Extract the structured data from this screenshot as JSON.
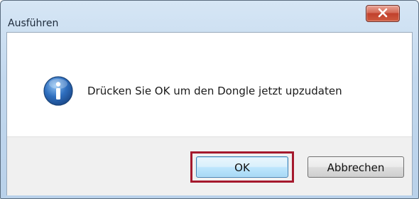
{
  "window": {
    "title": "Ausführen",
    "close_icon": "close-x-icon"
  },
  "message": {
    "icon": "info-icon",
    "text": "Drücken Sie OK um den Dongle jetzt upzudaten"
  },
  "buttons": {
    "ok_label": "OK",
    "cancel_label": "Abbrechen"
  },
  "colors": {
    "highlight_frame": "#a5192d",
    "close_button": "#c0402c",
    "info_icon": "#2f6fbf"
  }
}
